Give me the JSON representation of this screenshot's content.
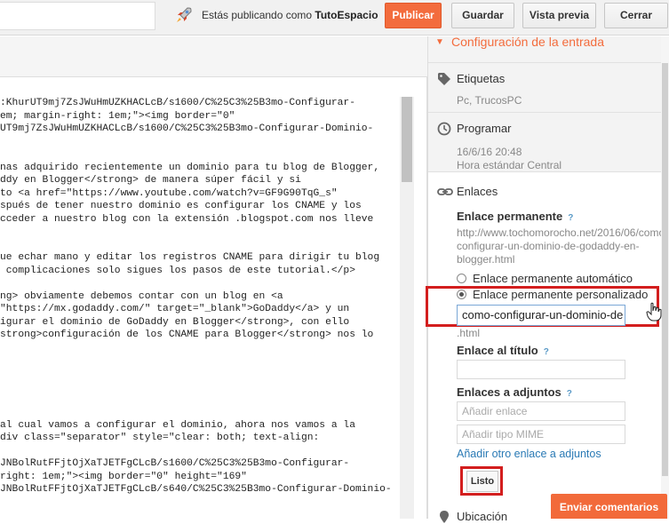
{
  "topbar": {
    "publishing_prefix": "Estás publicando como ",
    "blog_name": "TutoEspacio",
    "publish_label": "Publicar",
    "save_label": "Guardar",
    "preview_label": "Vista previa",
    "close_label": "Cerrar"
  },
  "editor": {
    "lines": [
      ":KhurUT9mj7ZsJWuHmUZKHACLcB/s1600/C%25C3%25B3mo-Configurar-",
      "em; margin-right: 1em;\"><img border=\"0\"",
      "UT9mj7ZsJWuHmUZKHACLcB/s1600/C%25C3%25B3mo-Configurar-Dominio-",
      "",
      "",
      "nas adquirido recientemente un dominio para tu blog de Blogger,",
      "ddy en Blogger</strong> de manera súper fácil y si",
      "to <a href=\"https://www.youtube.com/watch?v=GF9G90TqG_s\"",
      "spués de tener nuestro dominio es configurar los CNAME y los",
      "cceder a nuestro blog con la extensión .blogspot.com nos lleve",
      "",
      "",
      "ue echar mano y editar los registros CNAME para dirigir tu blog",
      " complicaciones solo sigues los pasos de este tutorial.</p>",
      "",
      "ng> obviamente debemos contar con un blog en <a",
      "\"https://mx.godaddy.com/\" target=\"_blank\">GoDaddy</a> y un",
      "igurar el dominio de GoDaddy en Blogger</strong>, con ello",
      "strong>configuración de los CNAME para Blogger</strong> nos lo",
      "",
      "",
      "",
      "",
      "",
      "",
      "al cual vamos a configurar el dominio, ahora nos vamos a la",
      "div class=\"separator\" style=\"clear: both; text-align:",
      "",
      "JNBolRutFFjtOjXaTJETFgCLcB/s1600/C%25C3%25B3mo-Configurar-",
      "right: 1em;\"><img border=\"0\" height=\"169\"",
      "JNBolRutFFjtOjXaTJETFgCLcB/s640/C%25C3%25B3mo-Configurar-Dominio-",
      "",
      ""
    ]
  },
  "panel": {
    "config_title": "Configuración de la entrada",
    "labels": {
      "title": "Etiquetas",
      "value": "Pc, TrucosPC"
    },
    "schedule": {
      "title": "Programar",
      "date": "16/6/16 20:48",
      "zone": "Hora estándar Central"
    },
    "links": {
      "title": "Enlaces",
      "permalink_label": "Enlace permanente",
      "help": "?",
      "permalink_url": "http://www.tochomorocho.net/2016/06/como-configurar-un-dominio-de-godaddy-en-blogger.html",
      "auto_label": "Enlace permanente automático",
      "custom_label": "Enlace permanente personalizado",
      "custom_value": "como-configurar-un-dominio-de",
      "suffix": ".html",
      "title_link_label": "Enlace al título",
      "attachments_label": "Enlaces a adjuntos",
      "add_link_placeholder": "Añadir enlace",
      "mime_placeholder": "Añadir tipo MIME",
      "add_another": "Añadir otro enlace a adjuntos",
      "done_label": "Listo",
      "next_section": "Ubicación"
    }
  },
  "feedback_label": "Enviar comentarios",
  "colors": {
    "accent": "#f36c3d",
    "highlight": "#d31e1e",
    "link": "#2a7ab5"
  }
}
